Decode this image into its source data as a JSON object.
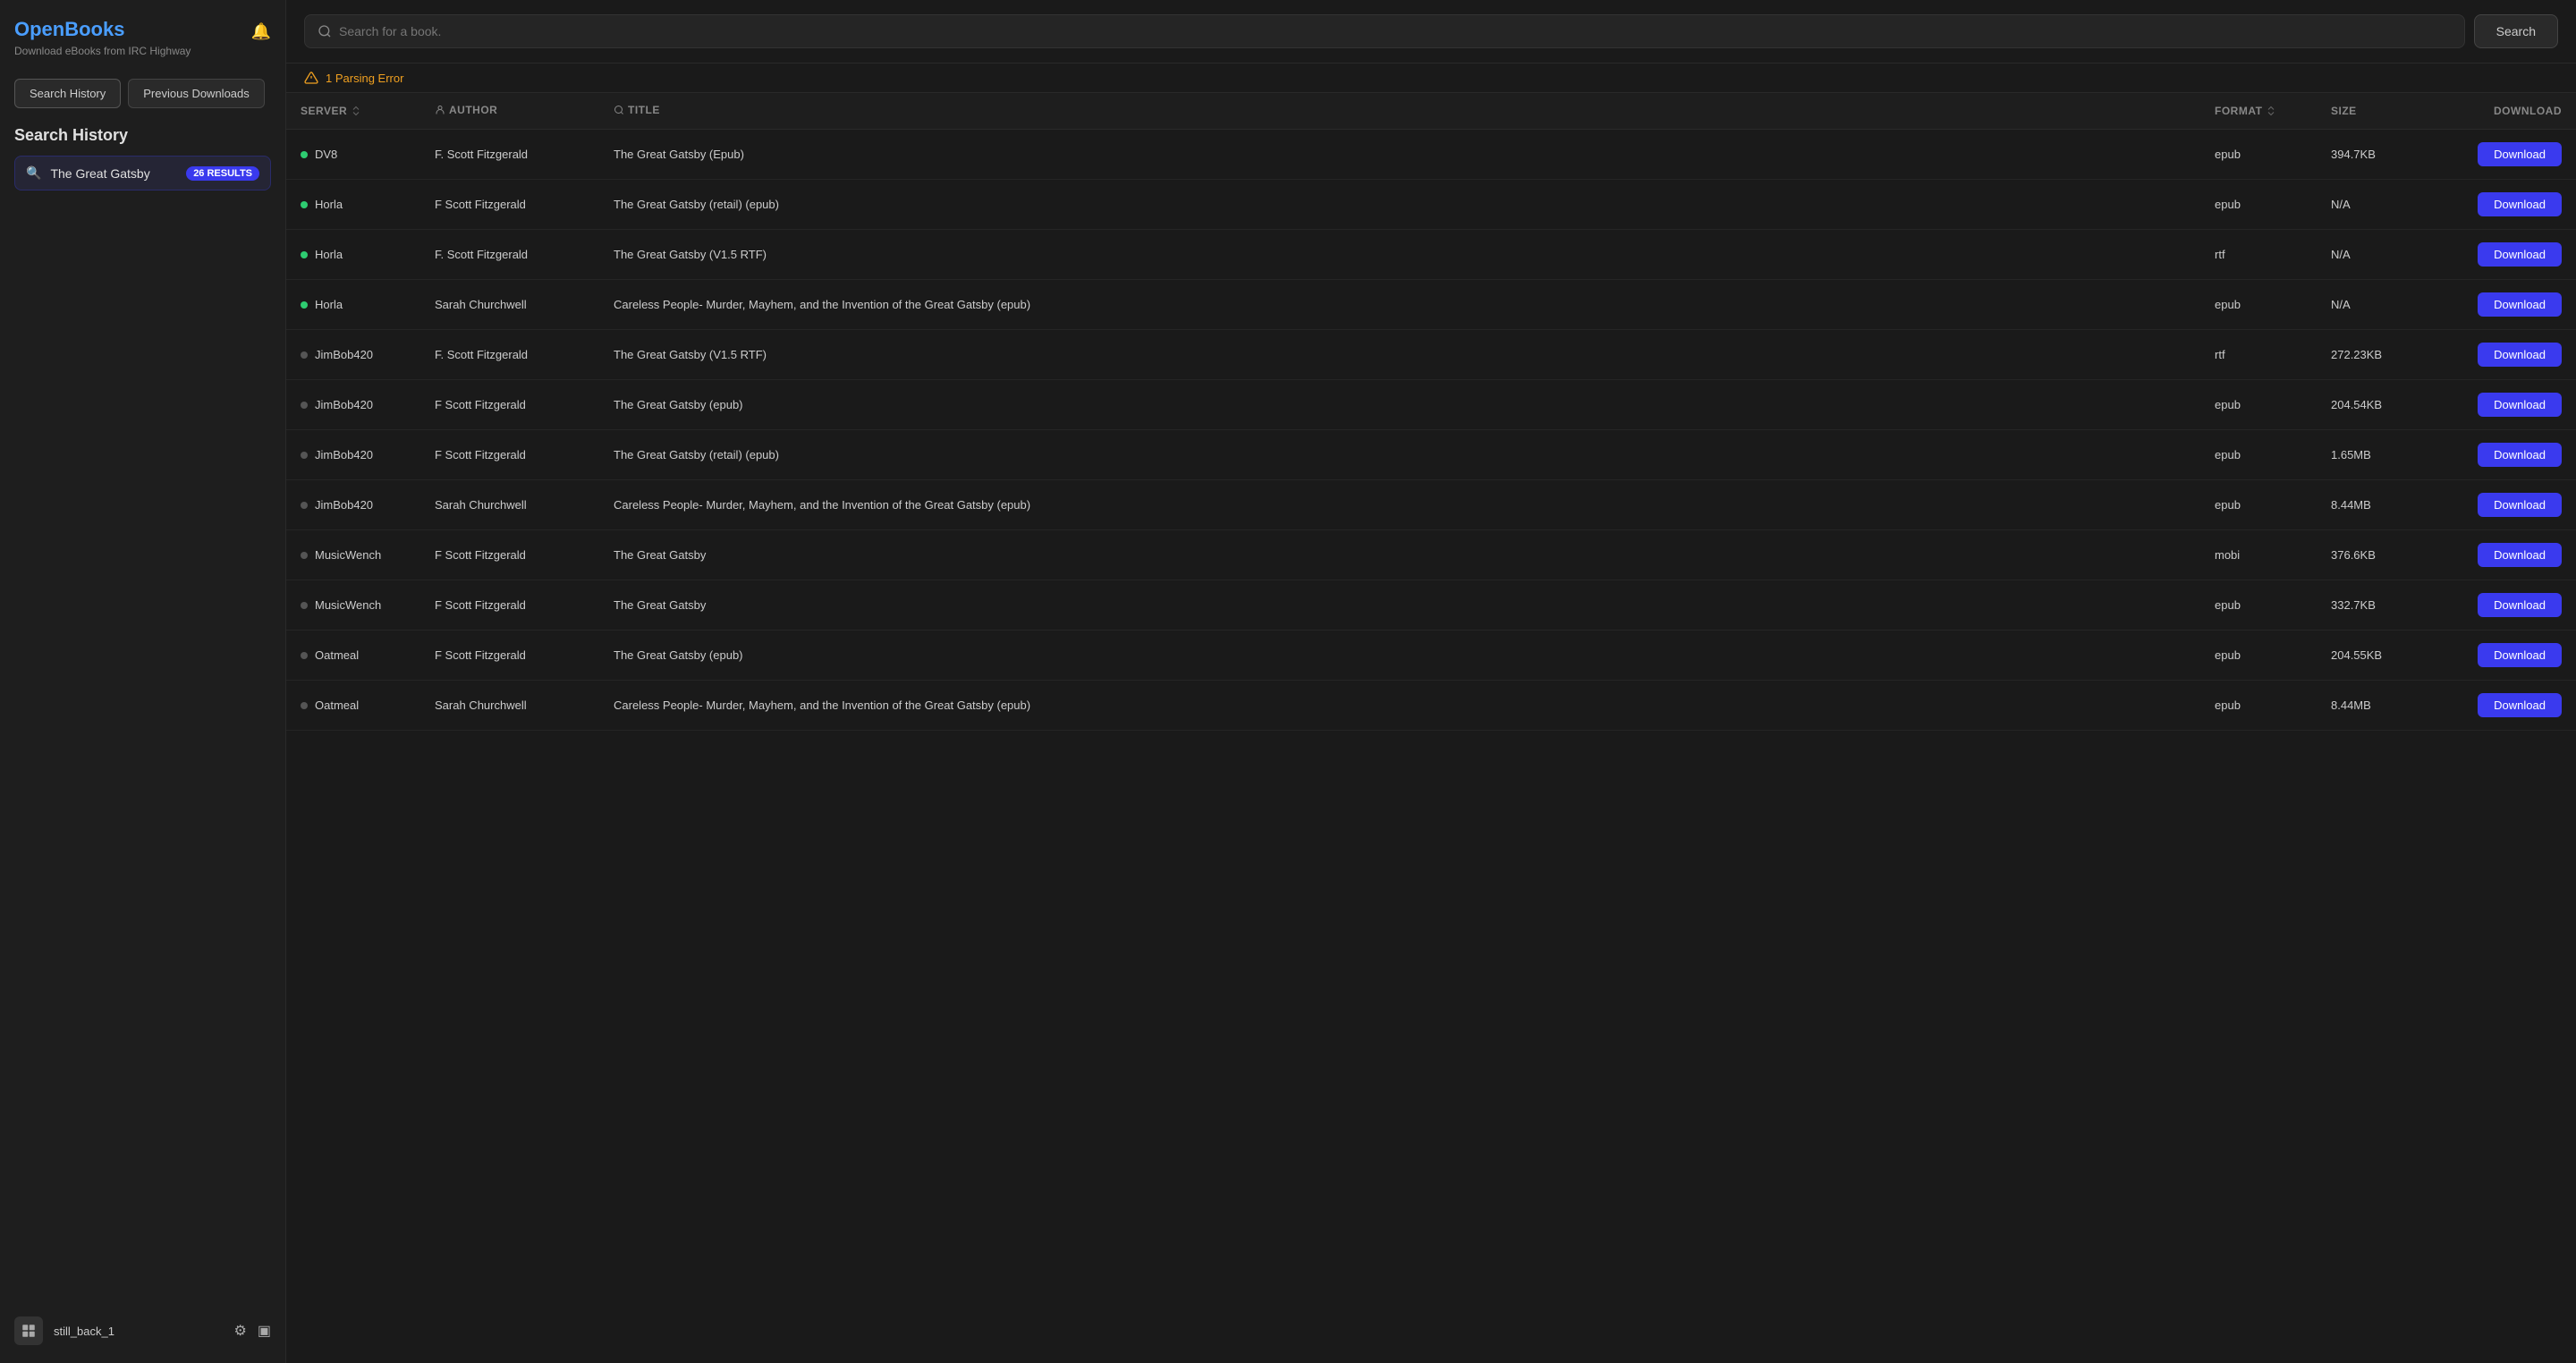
{
  "sidebar": {
    "app_title": "OpenBooks",
    "app_subtitle": "Download eBooks from IRC Highway",
    "bell_icon": "🔔",
    "buttons": [
      {
        "label": "Search History",
        "active": true
      },
      {
        "label": "Previous Downloads",
        "active": false
      }
    ],
    "search_history_label": "Search History",
    "history_items": [
      {
        "text": "The Great Gatsby",
        "results": "26 RESULTS"
      }
    ],
    "footer": {
      "username": "still_back_1",
      "settings_icon": "⚙",
      "layout_icon": "▣"
    }
  },
  "main": {
    "search_placeholder": "Search for a book.",
    "search_button_label": "Search",
    "parsing_error": "1 Parsing Error",
    "columns": {
      "server": "SERVER",
      "author": "AUTHOR",
      "title": "TITLE",
      "format": "FORMAT",
      "size": "SIZE",
      "download": "DOWNLOAD"
    },
    "results": [
      {
        "server": "DV8",
        "dot": "green",
        "author": "F. Scott Fitzgerald",
        "title": "The Great Gatsby (Epub)",
        "format": "epub",
        "size": "394.7KB",
        "download": "Download"
      },
      {
        "server": "Horla",
        "dot": "green",
        "author": "F Scott Fitzgerald",
        "title": "The Great Gatsby (retail) (epub)",
        "format": "epub",
        "size": "N/A",
        "download": "Download"
      },
      {
        "server": "Horla",
        "dot": "green",
        "author": "F. Scott Fitzgerald",
        "title": "The Great Gatsby (V1.5 RTF)",
        "format": "rtf",
        "size": "N/A",
        "download": "Download"
      },
      {
        "server": "Horla",
        "dot": "green",
        "author": "Sarah Churchwell",
        "title": "Careless People- Murder, Mayhem, and the Invention of the Great Gatsby (epub)",
        "format": "epub",
        "size": "N/A",
        "download": "Download"
      },
      {
        "server": "JimBob420",
        "dot": "gray",
        "author": "F. Scott Fitzgerald",
        "title": "The Great Gatsby (V1.5 RTF)",
        "format": "rtf",
        "size": "272.23KB",
        "download": "Download"
      },
      {
        "server": "JimBob420",
        "dot": "gray",
        "author": "F Scott Fitzgerald",
        "title": "The Great Gatsby (epub)",
        "format": "epub",
        "size": "204.54KB",
        "download": "Download"
      },
      {
        "server": "JimBob420",
        "dot": "gray",
        "author": "F Scott Fitzgerald",
        "title": "The Great Gatsby (retail) (epub)",
        "format": "epub",
        "size": "1.65MB",
        "download": "Download"
      },
      {
        "server": "JimBob420",
        "dot": "gray",
        "author": "Sarah Churchwell",
        "title": "Careless People- Murder, Mayhem, and the Invention of the Great Gatsby (epub)",
        "format": "epub",
        "size": "8.44MB",
        "download": "Download"
      },
      {
        "server": "MusicWench",
        "dot": "gray",
        "author": "F Scott Fitzgerald",
        "title": "The Great Gatsby",
        "format": "mobi",
        "size": "376.6KB",
        "download": "Download"
      },
      {
        "server": "MusicWench",
        "dot": "gray",
        "author": "F Scott Fitzgerald",
        "title": "The Great Gatsby",
        "format": "epub",
        "size": "332.7KB",
        "download": "Download"
      },
      {
        "server": "Oatmeal",
        "dot": "gray",
        "author": "F Scott Fitzgerald",
        "title": "The Great Gatsby (epub)",
        "format": "epub",
        "size": "204.55KB",
        "download": "Download"
      },
      {
        "server": "Oatmeal",
        "dot": "gray",
        "author": "Sarah Churchwell",
        "title": "Careless People- Murder, Mayhem, and the Invention of the Great Gatsby (epub)",
        "format": "epub",
        "size": "8.44MB",
        "download": "Download"
      }
    ],
    "download_label": "Download"
  }
}
